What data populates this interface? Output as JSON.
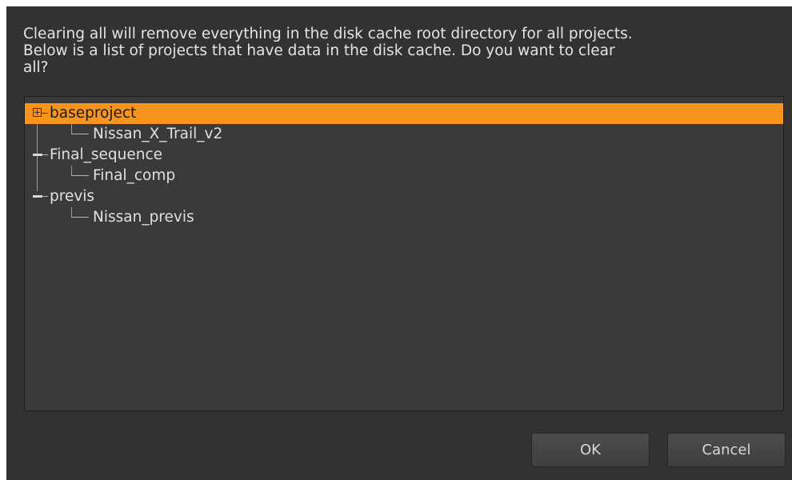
{
  "dialog": {
    "message": "Clearing all will remove everything in the disk cache root directory for all projects.\nBelow is a list of projects that have data in the disk cache. Do you want to clear\nall?"
  },
  "tree": {
    "projects": [
      {
        "name": "baseproject",
        "child": "Nissan_X_Trail_v2",
        "selected": true
      },
      {
        "name": "Final_sequence",
        "child": "Final_comp",
        "selected": false
      },
      {
        "name": "previs",
        "child": "Nissan_previs",
        "selected": false
      }
    ]
  },
  "buttons": {
    "ok_label": "OK",
    "cancel_label": "Cancel"
  },
  "colors": {
    "background": "#323232",
    "tree_background": "#3a3a3a",
    "selection": "#f7941d",
    "text": "#e0e0e0"
  }
}
